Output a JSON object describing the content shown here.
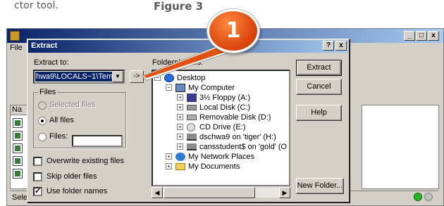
{
  "captions": {
    "left": "ctor tool.",
    "right": "Figure 3"
  },
  "background_window": {
    "title_fragment": "",
    "menu_fragment": "File",
    "list_header_fragment": "Na",
    "status_fragment": "Sele",
    "window_buttons": [
      "_",
      "□",
      "x"
    ],
    "status_led_colors": [
      "#2bb02b",
      "#c0c0c0"
    ]
  },
  "dialog": {
    "title": "Extract",
    "title_buttons": [
      "?",
      "x"
    ],
    "extract_to_label": "Extract to:",
    "path_value": "hwa9\\LOCALS~1\\Temp",
    "browse_label": "->",
    "folders_label": "Folders/drives:",
    "files_group": {
      "label": "Files",
      "selected_files": "Selected files",
      "all_files": "All files",
      "files_label": "Files:",
      "files_value": ""
    },
    "checkboxes": [
      {
        "label": "Overwrite existing files",
        "checked": false
      },
      {
        "label": "Skip older files",
        "checked": false
      },
      {
        "label": "Use folder names",
        "checked": true
      }
    ],
    "tree": [
      {
        "label": "Desktop",
        "icon": "desktop-icon",
        "expander": "minus"
      },
      {
        "label": "My Computer",
        "icon": "my-computer-icon",
        "expander": "minus"
      },
      {
        "label": "3½ Floppy (A:)",
        "icon": "floppy-icon",
        "expander": "plus"
      },
      {
        "label": "Local Disk (C:)",
        "icon": "hard-disk-icon",
        "expander": "plus"
      },
      {
        "label": "Removable Disk (D:)",
        "icon": "removable-disk-icon",
        "expander": "plus"
      },
      {
        "label": "CD Drive (E:)",
        "icon": "cd-drive-icon",
        "expander": "plus"
      },
      {
        "label": "dschwa9 on 'tiger' (H:)",
        "icon": "network-drive-icon",
        "expander": "plus"
      },
      {
        "label": "cansstudent$ on 'gold' (O",
        "icon": "network-drive-icon",
        "expander": "plus"
      },
      {
        "label": "My Network Places",
        "icon": "network-places-icon",
        "expander": "plus"
      },
      {
        "label": "My Documents",
        "icon": "my-documents-icon",
        "expander": "plus"
      }
    ],
    "buttons": {
      "extract": "Extract",
      "cancel": "Cancel",
      "help": "Help",
      "new_folder": "New Folder..."
    }
  },
  "callout": {
    "number": "1",
    "color": "#e0520f"
  }
}
